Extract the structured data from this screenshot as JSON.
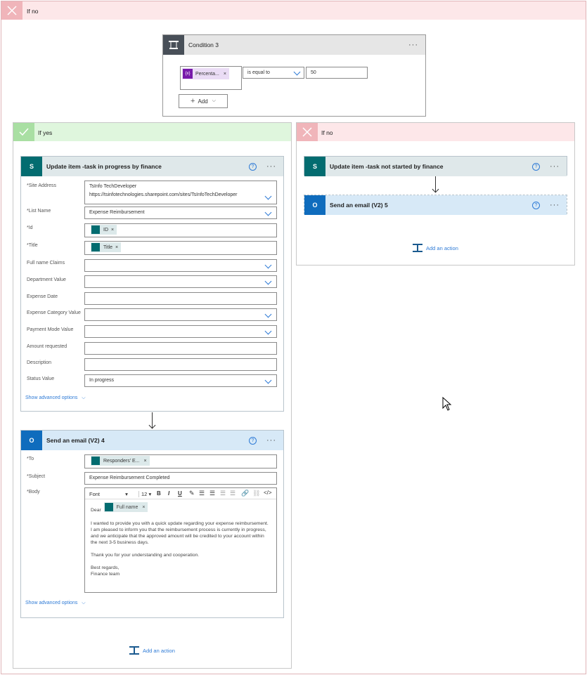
{
  "outer": {
    "label": "If no"
  },
  "condition": {
    "title": "Condition 3",
    "token": "Percenta...",
    "operator": "is equal to",
    "value": "50",
    "add_label": "Add"
  },
  "if_yes": {
    "label": "If yes"
  },
  "if_no": {
    "label": "If no"
  },
  "update_finance": {
    "title": "Update item -task in progress by finance",
    "fields": {
      "site_label": "*Site Address",
      "site_value_1": "TsInfo TechDeveloper",
      "site_value_2": "https://tsinfotechnologies.sharepoint.com/sites/TsInfoTechDeveloper",
      "list_label": "*List Name",
      "list_value": "Expense Reimbursement",
      "id_label": "*Id",
      "id_token": "ID",
      "title_label": "*Title",
      "title_token": "Title",
      "fullname_label": "Full name Claims",
      "department_label": "Department Value",
      "expdate_label": "Expense Date",
      "category_label": "Expense Category Value",
      "payment_label": "Payment Mode Value",
      "amount_label": "Amount requested",
      "description_label": "Description",
      "status_label": "Status Value",
      "status_value": "In progress"
    },
    "advanced": "Show advanced options"
  },
  "send_email_4": {
    "title": "Send an email (V2) 4",
    "to_label": "*To",
    "to_token": "Responders' E...",
    "subject_label": "*Subject",
    "subject_value": "Expense Reimbursement Completed",
    "body_label": "*Body",
    "toolbar": {
      "font": "Font",
      "size": "12",
      "bold": "B",
      "italic": "I",
      "underline": "U"
    },
    "body": {
      "dear": "Dear",
      "fullname_token": "Full name",
      "p1": "I wanted to provide you with a quick update regarding your expense reimbursement. I am pleased to inform you that the reimbursement process is currently in progress, and we anticipate that the approved amount will be credited to your account within the next 3-5 business days.",
      "p2": "Thank you for your understanding and cooperation.",
      "p3a": "Best regards,",
      "p3b": "Finance team"
    },
    "advanced": "Show advanced options"
  },
  "add_action_left": "Add an action",
  "update_not_started": {
    "title": "Update item -task not started by finance"
  },
  "send_email_5": {
    "title": "Send an email (V2) 5"
  },
  "add_action_right": "Add an action",
  "colors": {
    "sharepoint": "#036c70",
    "outlook": "#0f6cbd",
    "link": "#2f7bd6",
    "no_header": "#fde7e9",
    "yes_header": "#dff6dd"
  }
}
